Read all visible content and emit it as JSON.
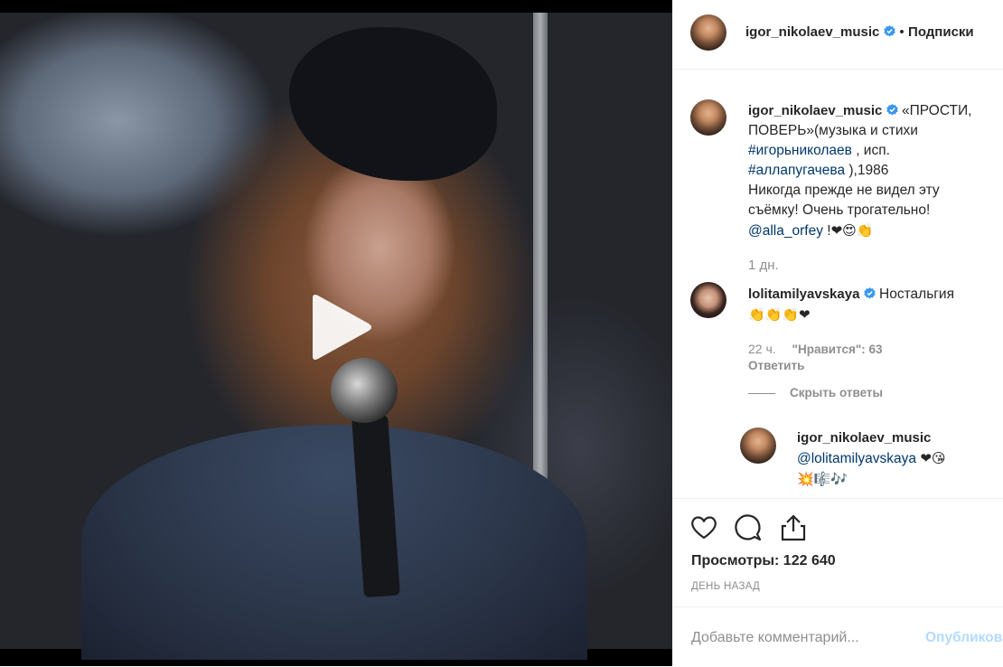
{
  "post": {
    "author": "igor_nikolaev_music",
    "follow_separator": "•",
    "follow_label": "Подписки",
    "caption": {
      "text_line1": "«ПРОСТИ,",
      "text_line2": "ПОВЕРЬ»(музыка и стихи",
      "hashtag1": "#игорьниколаев",
      "after_hashtag1": " , исп.",
      "hashtag2": "#аллапугачева",
      "after_hashtag2": " ),1986",
      "line5": "Никогда прежде не видел эту",
      "line6": "съёмку! Очень трогательно!",
      "mention": "@alla_orfey",
      "after_mention": " !",
      "emojis": "❤😍👏",
      "time": "1 дн."
    },
    "comments": [
      {
        "author": "lolitamilyavskaya",
        "text": "Ностальгия",
        "emojis": "👏👏👏❤",
        "time": "22 ч.",
        "likes": "\"Нравится\": 63",
        "reply_label": "Ответить",
        "hide_replies_label": "Скрыть ответы",
        "replies": [
          {
            "author": "igor_nikolaev_music",
            "mention": "@lolitamilyavskaya",
            "emojis": "❤😘",
            "emojis2": "💥🎼🎶"
          }
        ]
      }
    ],
    "views_label": "Просмотры:",
    "views_value": "122 640",
    "date_label": "ДЕНЬ НАЗАД",
    "comment_placeholder": "Добавьте комментарий...",
    "publish_label": "Опубликовать"
  },
  "icons": {
    "like": "heart-icon",
    "comment": "comment-icon",
    "share": "share-icon",
    "play": "play-icon",
    "verified": "verified-badge-icon"
  },
  "colors": {
    "verified": "#3897f0",
    "link": "#00376b",
    "muted": "#8e8e8e",
    "publish_disabled": "#b3dbff"
  }
}
